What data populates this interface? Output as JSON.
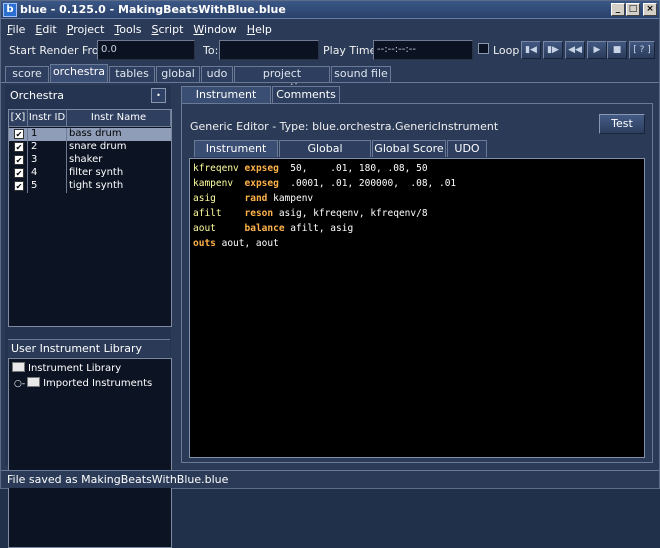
{
  "window": {
    "title": "blue - 0.125.0 - MakingBeatsWithBlue.blue",
    "app_icon": "b"
  },
  "menu": [
    "File",
    "Edit",
    "Project",
    "Tools",
    "Script",
    "Window",
    "Help"
  ],
  "render": {
    "start_label": "Start Render From:",
    "start_value": "0.0",
    "to_label": "To:",
    "to_value": "",
    "play_time_label": "Play Time:",
    "play_time_value": "--:--:--:--",
    "loop_label": "Loop",
    "help_label": "[ ? ]"
  },
  "main_tabs": [
    "score",
    "orchestra",
    "tables",
    "global",
    "udo",
    "project properties",
    "sound file"
  ],
  "orchestra": {
    "header": "Orchestra",
    "add_label": "•",
    "columns": [
      "[X]",
      "Instr ID",
      "Instr Name"
    ],
    "rows": [
      {
        "checked": true,
        "id": "1",
        "name": "bass drum"
      },
      {
        "checked": true,
        "id": "2",
        "name": "snare drum"
      },
      {
        "checked": true,
        "id": "3",
        "name": "shaker"
      },
      {
        "checked": true,
        "id": "4",
        "name": "filter synth"
      },
      {
        "checked": true,
        "id": "5",
        "name": "tight synth"
      }
    ],
    "check_glyph": "✔"
  },
  "library": {
    "header": "User Instrument Library",
    "nodes": [
      "Instrument Library",
      "Imported Instruments"
    ]
  },
  "editor": {
    "tabs": [
      "Instrument Editor",
      "Comments"
    ],
    "generic_label": "Generic Editor - Type: blue.orchestra.GenericInstrument",
    "test_label": "Test",
    "sub_tabs": [
      "Instrument Text",
      "Global Orchestra",
      "Global Score",
      "UDO"
    ],
    "code": [
      {
        "var": "kfreqenv",
        "op": "expseg",
        "args": "  50,    .01, 180, .08, 50"
      },
      {
        "var": "kampenv ",
        "op": "expseg",
        "args": "  .0001, .01, 200000,  .08, .01"
      },
      {
        "var": "asig    ",
        "op": "rand",
        "args": " kampenv"
      },
      {
        "var": "afilt   ",
        "op": "reson",
        "args": " asig, kfreqenv, kfreqenv/8"
      },
      {
        "var": "aout    ",
        "op": "balance",
        "args": " afilt, asig"
      },
      {
        "var": "",
        "op": "outs",
        "args": " aout, aout"
      }
    ]
  },
  "status": {
    "text": "File saved as MakingBeatsWithBlue.blue"
  }
}
